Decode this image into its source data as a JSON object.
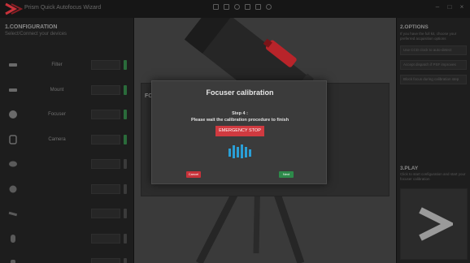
{
  "app": {
    "title": "Prism Quick Autofocus Wizard"
  },
  "left_panel": {
    "title": "1.CONFIGURATION",
    "subtitle": "Select/Connect your devices",
    "devices": [
      {
        "label": "Filter",
        "icon": "mount-icon",
        "status": "connected"
      },
      {
        "label": "Mount",
        "icon": "mount-icon",
        "status": "connected"
      },
      {
        "label": "Focuser",
        "icon": "focuser-icon",
        "status": "connected"
      },
      {
        "label": "Camera",
        "icon": "camera-icon",
        "status": "connected"
      },
      {
        "label": "",
        "icon": "filter-wheel-icon",
        "status": "disconnected"
      },
      {
        "label": "",
        "icon": "guide-camera-icon",
        "status": "disconnected"
      },
      {
        "label": "",
        "icon": "telescope-icon",
        "status": "disconnected"
      },
      {
        "label": "",
        "icon": "rotator-icon",
        "status": "disconnected"
      },
      {
        "label": "",
        "icon": "dome-icon",
        "status": "disconnected"
      }
    ]
  },
  "background_panel": {
    "title": "FO"
  },
  "modal": {
    "title": "Focuser calibration",
    "step": "Step 4 :",
    "message": "Please wait the calibration procedure to finish",
    "emergency_label": "EMERGENCY STOP",
    "cancel_label": "Cancel",
    "next_label": "Next"
  },
  "right_panel": {
    "options_title": "2.OPTIONS",
    "options_sub": "If you have the full kit, choose your preferred acquisition options",
    "options": [
      "Use CCD clock to auto-detect",
      "Accept dispatch if PSF improves",
      "Block focus during calibration step"
    ],
    "play_title": "3.PLAY",
    "play_sub": "Click to start configuration and start your focuser calibration",
    "play_icon": "play-arrow-icon"
  },
  "colors": {
    "accent_red": "#d03a40",
    "success_green": "#2d8a4a",
    "loader_blue": "#2a9fd6",
    "status_green": "#2a6b3a"
  }
}
